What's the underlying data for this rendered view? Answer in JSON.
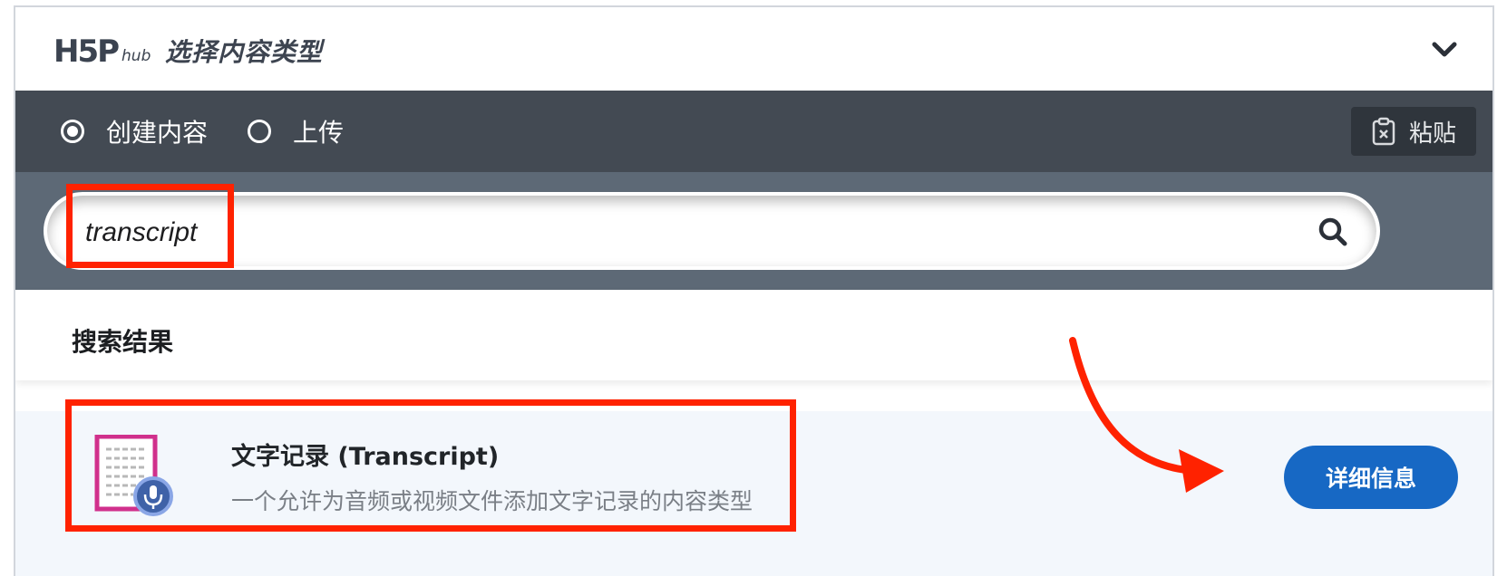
{
  "header": {
    "logo_main": "H5P",
    "logo_sub": "hub",
    "title": "选择内容类型"
  },
  "tabs": [
    {
      "label": "创建内容",
      "selected": true
    },
    {
      "label": "上传",
      "selected": false
    }
  ],
  "paste_button": {
    "label": "粘贴"
  },
  "search": {
    "value": "transcript"
  },
  "results": {
    "heading": "搜索结果",
    "items": [
      {
        "name": "文字记录 (Transcript)",
        "description": "一个允许为音频或视频文件添加文字记录的内容类型",
        "details_label": "详细信息"
      }
    ]
  },
  "colors": {
    "tab_bar": "#434a53",
    "search_band": "#5d6976",
    "details_button": "#1768c4",
    "annotation": "#ff2200",
    "icon_accent": "#d0308c"
  },
  "icons": [
    "chevron-down-icon",
    "clipboard-icon",
    "search-icon",
    "transcript-icon",
    "microphone-icon"
  ]
}
